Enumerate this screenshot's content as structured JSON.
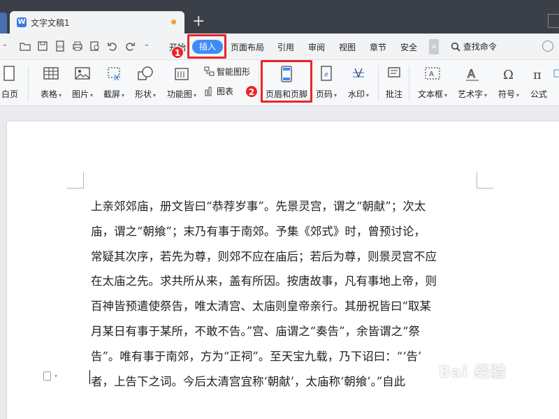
{
  "window": {
    "tab_title": "文字文稿1",
    "tab_icon": "W",
    "new_tab": "+"
  },
  "menu": {
    "items": [
      "开始",
      "插入",
      "页面布局",
      "引用",
      "审阅",
      "视图",
      "章节",
      "安全"
    ],
    "active": "插入",
    "more": ">",
    "search_label": "查找命令"
  },
  "ribbon": {
    "buttons": [
      {
        "label": "白页",
        "icon": "blank-page-icon"
      },
      {
        "label": "表格",
        "icon": "table-icon"
      },
      {
        "label": "图片",
        "icon": "picture-icon"
      },
      {
        "label": "截屏",
        "icon": "screenshot-icon"
      },
      {
        "label": "形状",
        "icon": "shape-icon"
      },
      {
        "label": "功能图",
        "icon": "function-chart-icon"
      },
      {
        "label": "页眉和页脚",
        "icon": "header-footer-icon"
      },
      {
        "label": "页码",
        "icon": "page-number-icon"
      },
      {
        "label": "水印",
        "icon": "watermark-icon"
      },
      {
        "label": "批注",
        "icon": "comment-icon"
      },
      {
        "label": "文本框",
        "icon": "textbox-icon"
      },
      {
        "label": "艺术字",
        "icon": "wordart-icon"
      },
      {
        "label": "符号",
        "icon": "symbol-icon"
      },
      {
        "label": "公式",
        "icon": "formula-icon"
      }
    ],
    "small": {
      "smart_shape": "智能图形",
      "chart": "图表"
    }
  },
  "annotations": {
    "step1": "1",
    "step2": "2"
  },
  "document": {
    "lines": [
      "上亲郊郊庙，册文皆曰“恭荐岁事”。先景灵宫，谓之“朝献”；次太",
      "庙，谓之“朝飨”；末乃有事于南郊。予集《郊式》时，曾预讨论，",
      "常疑其次序，若先为尊，则郊不应在庙后；若后为尊，则景灵宫不应",
      "在太庙之先。求共所从来，盖有所因。按唐故事，凡有事地上帝，则",
      "百神皆预遣使祭告，唯太清宫、太庙则皇帝亲行。其册祝皆曰“取某",
      "月某日有事于某所，不敢不告。”宫、庙谓之“奏告”，余皆谓之“祭",
      "告”。唯有事于南郊，方为“正祠”。至天宝九载，乃下诏曰：“‘告’",
      "者，上告下之词。今后太清宫宜称‘朝献’，太庙称‘朝飨’。”自此"
    ]
  },
  "watermark": "Bai 经验",
  "colors": {
    "accent": "#3d8cf5",
    "annotation": "#e8252a",
    "titlebar": "#3b3f47"
  }
}
